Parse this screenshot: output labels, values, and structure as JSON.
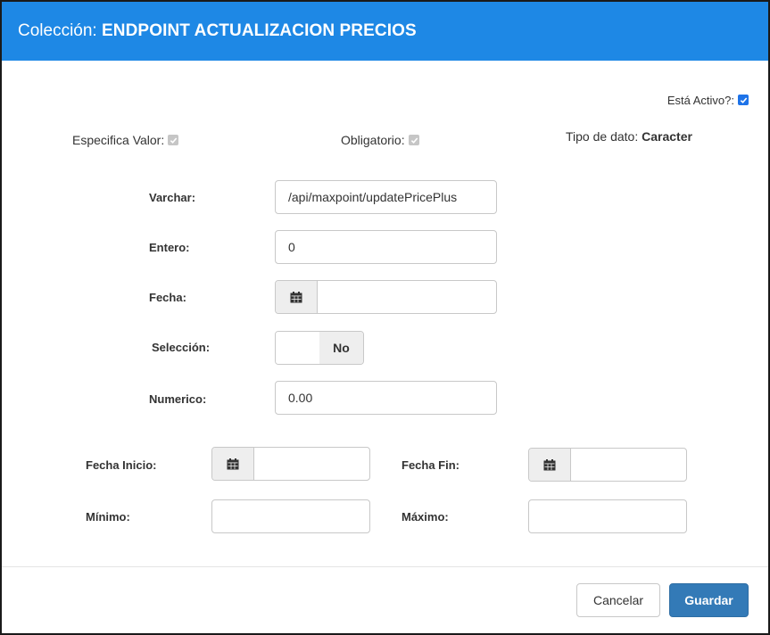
{
  "header": {
    "title_prefix": "Colección:",
    "title_name": "ENDPOINT ACTUALIZACION PRECIOS",
    "background_color": "#1e88e5"
  },
  "flags": {
    "activo_label": "Está Activo?:",
    "activo_checked": true,
    "especifica_valor_label": "Especifica Valor:",
    "especifica_valor_checked": true,
    "obligatorio_label": "Obligatorio:",
    "obligatorio_checked": true,
    "tipo_dato_label": "Tipo de dato:",
    "tipo_dato_value": "Caracter"
  },
  "fields": {
    "varchar_label": "Varchar:",
    "varchar_value": "/api/maxpoint/updatePricePlus",
    "entero_label": "Entero:",
    "entero_value": "0",
    "fecha_label": "Fecha:",
    "fecha_value": "",
    "seleccion_label": "Selección:",
    "seleccion_value": "No",
    "numerico_label": "Numerico:",
    "numerico_value": "0.00"
  },
  "range": {
    "fecha_inicio_label": "Fecha Inicio:",
    "fecha_inicio_value": "",
    "fecha_fin_label": "Fecha Fin:",
    "fecha_fin_value": "",
    "minimo_label": "Mínimo:",
    "minimo_value": "",
    "maximo_label": "Máximo:",
    "maximo_value": ""
  },
  "footer": {
    "cancel_label": "Cancelar",
    "save_label": "Guardar",
    "primary_color": "#337ab7"
  },
  "icons": {
    "calendar": "calendar-icon",
    "checkmark": "check-icon"
  }
}
